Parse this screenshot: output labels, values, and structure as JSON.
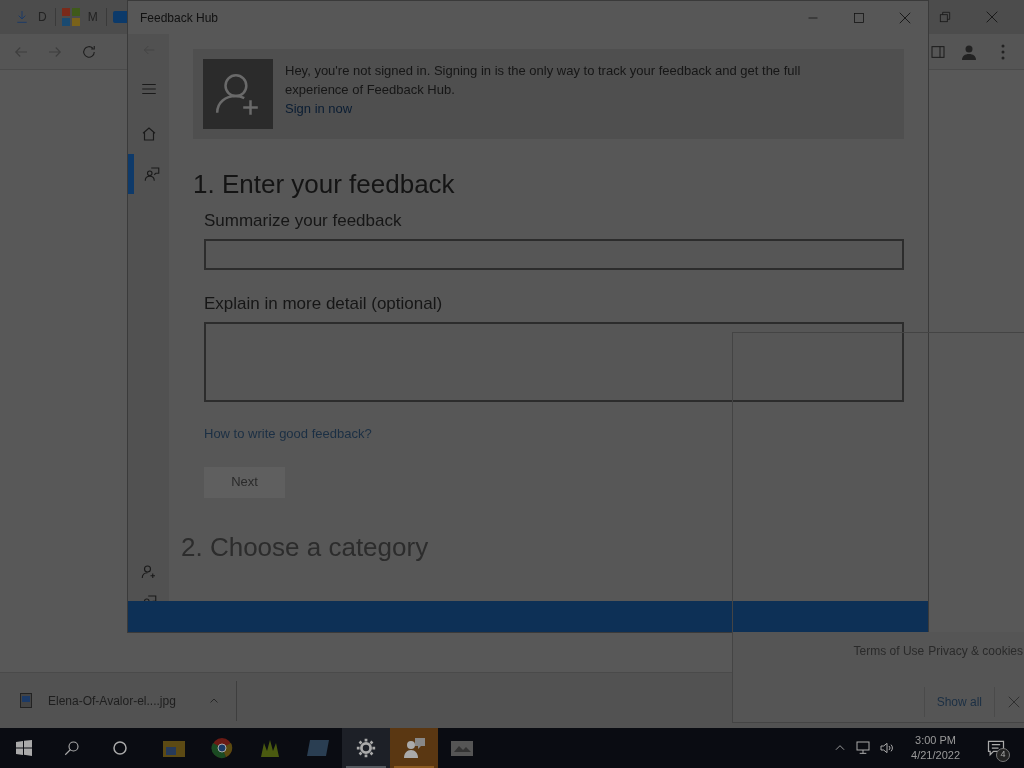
{
  "browser": {
    "tabs": [
      {
        "label": "D"
      },
      {
        "label": "M"
      }
    ]
  },
  "feedback_window": {
    "title": "Feedback Hub",
    "banner": {
      "message": "Hey, you're not signed in. Signing in is the only way to track your feedback and get the full experience of Feedback Hub.",
      "link": "Sign in now"
    },
    "nav": [
      {
        "kind": "home",
        "selected": false
      },
      {
        "kind": "feedback",
        "selected": true
      }
    ],
    "section1": {
      "heading": "1. Enter your feedback",
      "fields": [
        {
          "label": "Summarize your feedback",
          "kind": "line"
        },
        {
          "label": "Explain in more detail (optional)",
          "kind": "area"
        }
      ],
      "help_link": "How to write good feedback?",
      "next_button": {
        "label": "Next",
        "disabled": true
      }
    },
    "section2": {
      "heading": "2. Choose a category"
    }
  },
  "popup": {
    "links": [
      "Terms of Use",
      "Privacy & cookies"
    ]
  },
  "download_bar": {
    "file": "Elena-Of-Avalor-el....jpg",
    "show_all": "Show all"
  },
  "taskbar": {
    "apps": [
      {
        "kind": "folder",
        "highlighted": false,
        "selected": false
      },
      {
        "kind": "chrome",
        "highlighted": false,
        "selected": false
      },
      {
        "kind": "plant",
        "highlighted": false,
        "selected": false
      },
      {
        "kind": "monitor",
        "highlighted": false,
        "selected": false
      },
      {
        "kind": "gear",
        "highlighted": true,
        "selected": false
      },
      {
        "kind": "feedback",
        "highlighted": false,
        "selected": true
      },
      {
        "kind": "photos",
        "highlighted": false,
        "selected": false
      }
    ],
    "time": "3:00 PM",
    "date": "4/21/2022",
    "notifications": "4"
  }
}
